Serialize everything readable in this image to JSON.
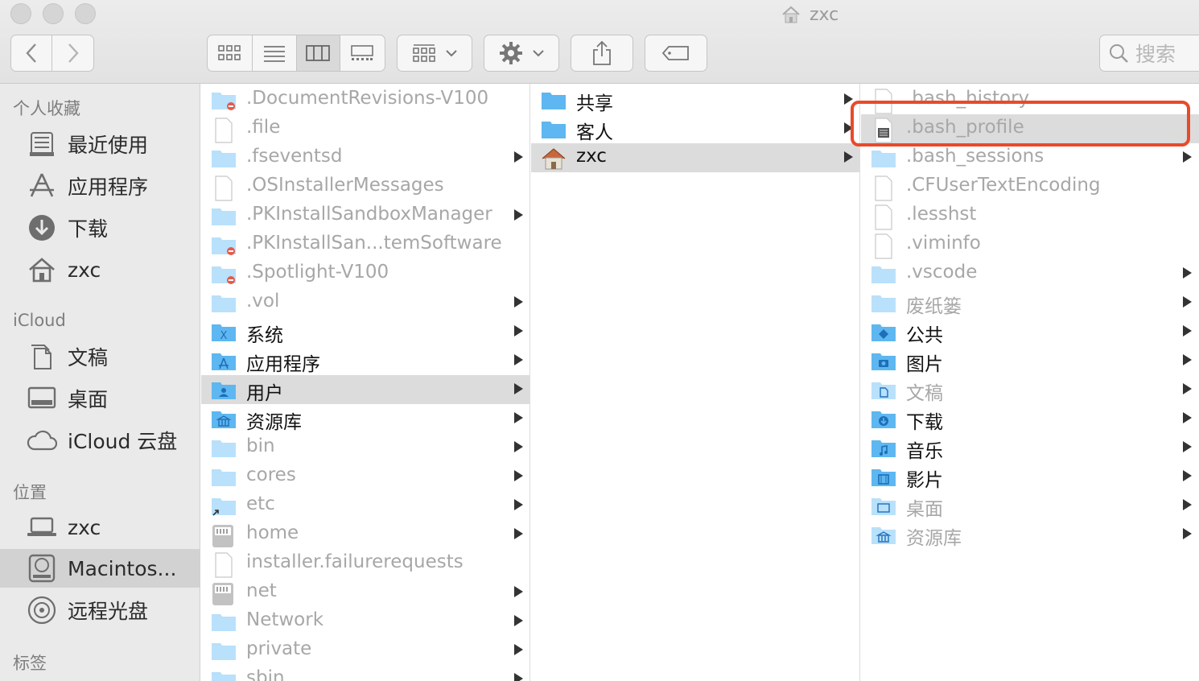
{
  "window": {
    "title": "zxc"
  },
  "toolbar": {
    "search_placeholder": "搜索"
  },
  "sidebar": {
    "sections": [
      {
        "heading": "个人收藏",
        "items": [
          {
            "label": "最近使用",
            "icon": "recents-icon"
          },
          {
            "label": "应用程序",
            "icon": "applications-icon"
          },
          {
            "label": "下载",
            "icon": "downloads-icon"
          },
          {
            "label": "zxc",
            "icon": "home-icon"
          }
        ]
      },
      {
        "heading": "iCloud",
        "items": [
          {
            "label": "文稿",
            "icon": "documents-icon"
          },
          {
            "label": "桌面",
            "icon": "desktop-icon"
          },
          {
            "label": "iCloud 云盘",
            "icon": "cloud-icon"
          }
        ]
      },
      {
        "heading": "位置",
        "items": [
          {
            "label": "zxc",
            "icon": "laptop-icon"
          },
          {
            "label": "Macintos...",
            "icon": "hard-disk-icon",
            "selected": true
          },
          {
            "label": "远程光盘",
            "icon": "optical-disc-icon"
          }
        ]
      },
      {
        "heading": "标签",
        "items": []
      }
    ]
  },
  "columns": [
    {
      "rows": [
        {
          "label": ".DocumentRevisions-V100",
          "icon": "folder-restricted",
          "dim": true,
          "arrow": false
        },
        {
          "label": ".file",
          "icon": "file",
          "dim": true,
          "arrow": false
        },
        {
          "label": ".fseventsd",
          "icon": "folder",
          "dim": true,
          "arrow": true
        },
        {
          "label": ".OSInstallerMessages",
          "icon": "file",
          "dim": true,
          "arrow": false
        },
        {
          "label": ".PKInstallSandboxManager",
          "icon": "folder",
          "dim": true,
          "arrow": true
        },
        {
          "label": ".PKInstallSan...temSoftware",
          "icon": "folder-restricted",
          "dim": true,
          "arrow": false
        },
        {
          "label": ".Spotlight-V100",
          "icon": "folder-restricted",
          "dim": true,
          "arrow": false
        },
        {
          "label": ".vol",
          "icon": "folder",
          "dim": true,
          "arrow": true
        },
        {
          "label": "系统",
          "icon": "folder-system",
          "dim": false,
          "arrow": true
        },
        {
          "label": "应用程序",
          "icon": "folder-apps",
          "dim": false,
          "arrow": true
        },
        {
          "label": "用户",
          "icon": "folder-users",
          "dim": false,
          "arrow": true,
          "selected": true
        },
        {
          "label": "资源库",
          "icon": "folder-library",
          "dim": false,
          "arrow": true
        },
        {
          "label": "bin",
          "icon": "folder",
          "dim": true,
          "arrow": true
        },
        {
          "label": "cores",
          "icon": "folder",
          "dim": true,
          "arrow": true
        },
        {
          "label": "etc",
          "icon": "folder-alias",
          "dim": true,
          "arrow": true
        },
        {
          "label": "home",
          "icon": "network-volume",
          "dim": true,
          "arrow": true
        },
        {
          "label": "installer.failurerequests",
          "icon": "file",
          "dim": true,
          "arrow": false
        },
        {
          "label": "net",
          "icon": "network-volume",
          "dim": true,
          "arrow": true
        },
        {
          "label": "Network",
          "icon": "folder",
          "dim": true,
          "arrow": true
        },
        {
          "label": "private",
          "icon": "folder",
          "dim": true,
          "arrow": true
        },
        {
          "label": "sbin",
          "icon": "folder",
          "dim": true,
          "arrow": true
        }
      ]
    },
    {
      "rows": [
        {
          "label": "共享",
          "icon": "folder",
          "dim": false,
          "arrow": true
        },
        {
          "label": "客人",
          "icon": "folder",
          "dim": false,
          "arrow": true
        },
        {
          "label": "zxc",
          "icon": "home",
          "dim": false,
          "arrow": true,
          "selected": true
        }
      ]
    },
    {
      "rows": [
        {
          "label": ".bash_history",
          "icon": "file",
          "dim": true,
          "arrow": false
        },
        {
          "label": ".bash_profile",
          "icon": "file-doc",
          "dim": true,
          "arrow": false,
          "selected": true
        },
        {
          "label": ".bash_sessions",
          "icon": "folder",
          "dim": true,
          "arrow": true
        },
        {
          "label": ".CFUserTextEncoding",
          "icon": "file",
          "dim": true,
          "arrow": false
        },
        {
          "label": ".lesshst",
          "icon": "file",
          "dim": true,
          "arrow": false
        },
        {
          "label": ".viminfo",
          "icon": "file",
          "dim": true,
          "arrow": false
        },
        {
          "label": ".vscode",
          "icon": "folder",
          "dim": true,
          "arrow": true
        },
        {
          "label": "废纸篓",
          "icon": "folder",
          "dim": true,
          "arrow": true
        },
        {
          "label": "公共",
          "icon": "folder-public",
          "dim": false,
          "arrow": true
        },
        {
          "label": "图片",
          "icon": "folder-pictures",
          "dim": false,
          "arrow": true
        },
        {
          "label": "文稿",
          "icon": "folder-documents",
          "dim": true,
          "arrow": true
        },
        {
          "label": "下载",
          "icon": "folder-downloads",
          "dim": false,
          "arrow": true
        },
        {
          "label": "音乐",
          "icon": "folder-music",
          "dim": false,
          "arrow": true
        },
        {
          "label": "影片",
          "icon": "folder-movies",
          "dim": false,
          "arrow": true
        },
        {
          "label": "桌面",
          "icon": "folder-desktop",
          "dim": true,
          "arrow": true
        },
        {
          "label": "资源库",
          "icon": "folder-library",
          "dim": true,
          "arrow": true
        }
      ]
    }
  ],
  "colors": {
    "folder": "#5eb7f0",
    "folder_light": "#b8e0fa",
    "selection": "#dcdcdc",
    "highlight_box": "#e94a2a"
  }
}
